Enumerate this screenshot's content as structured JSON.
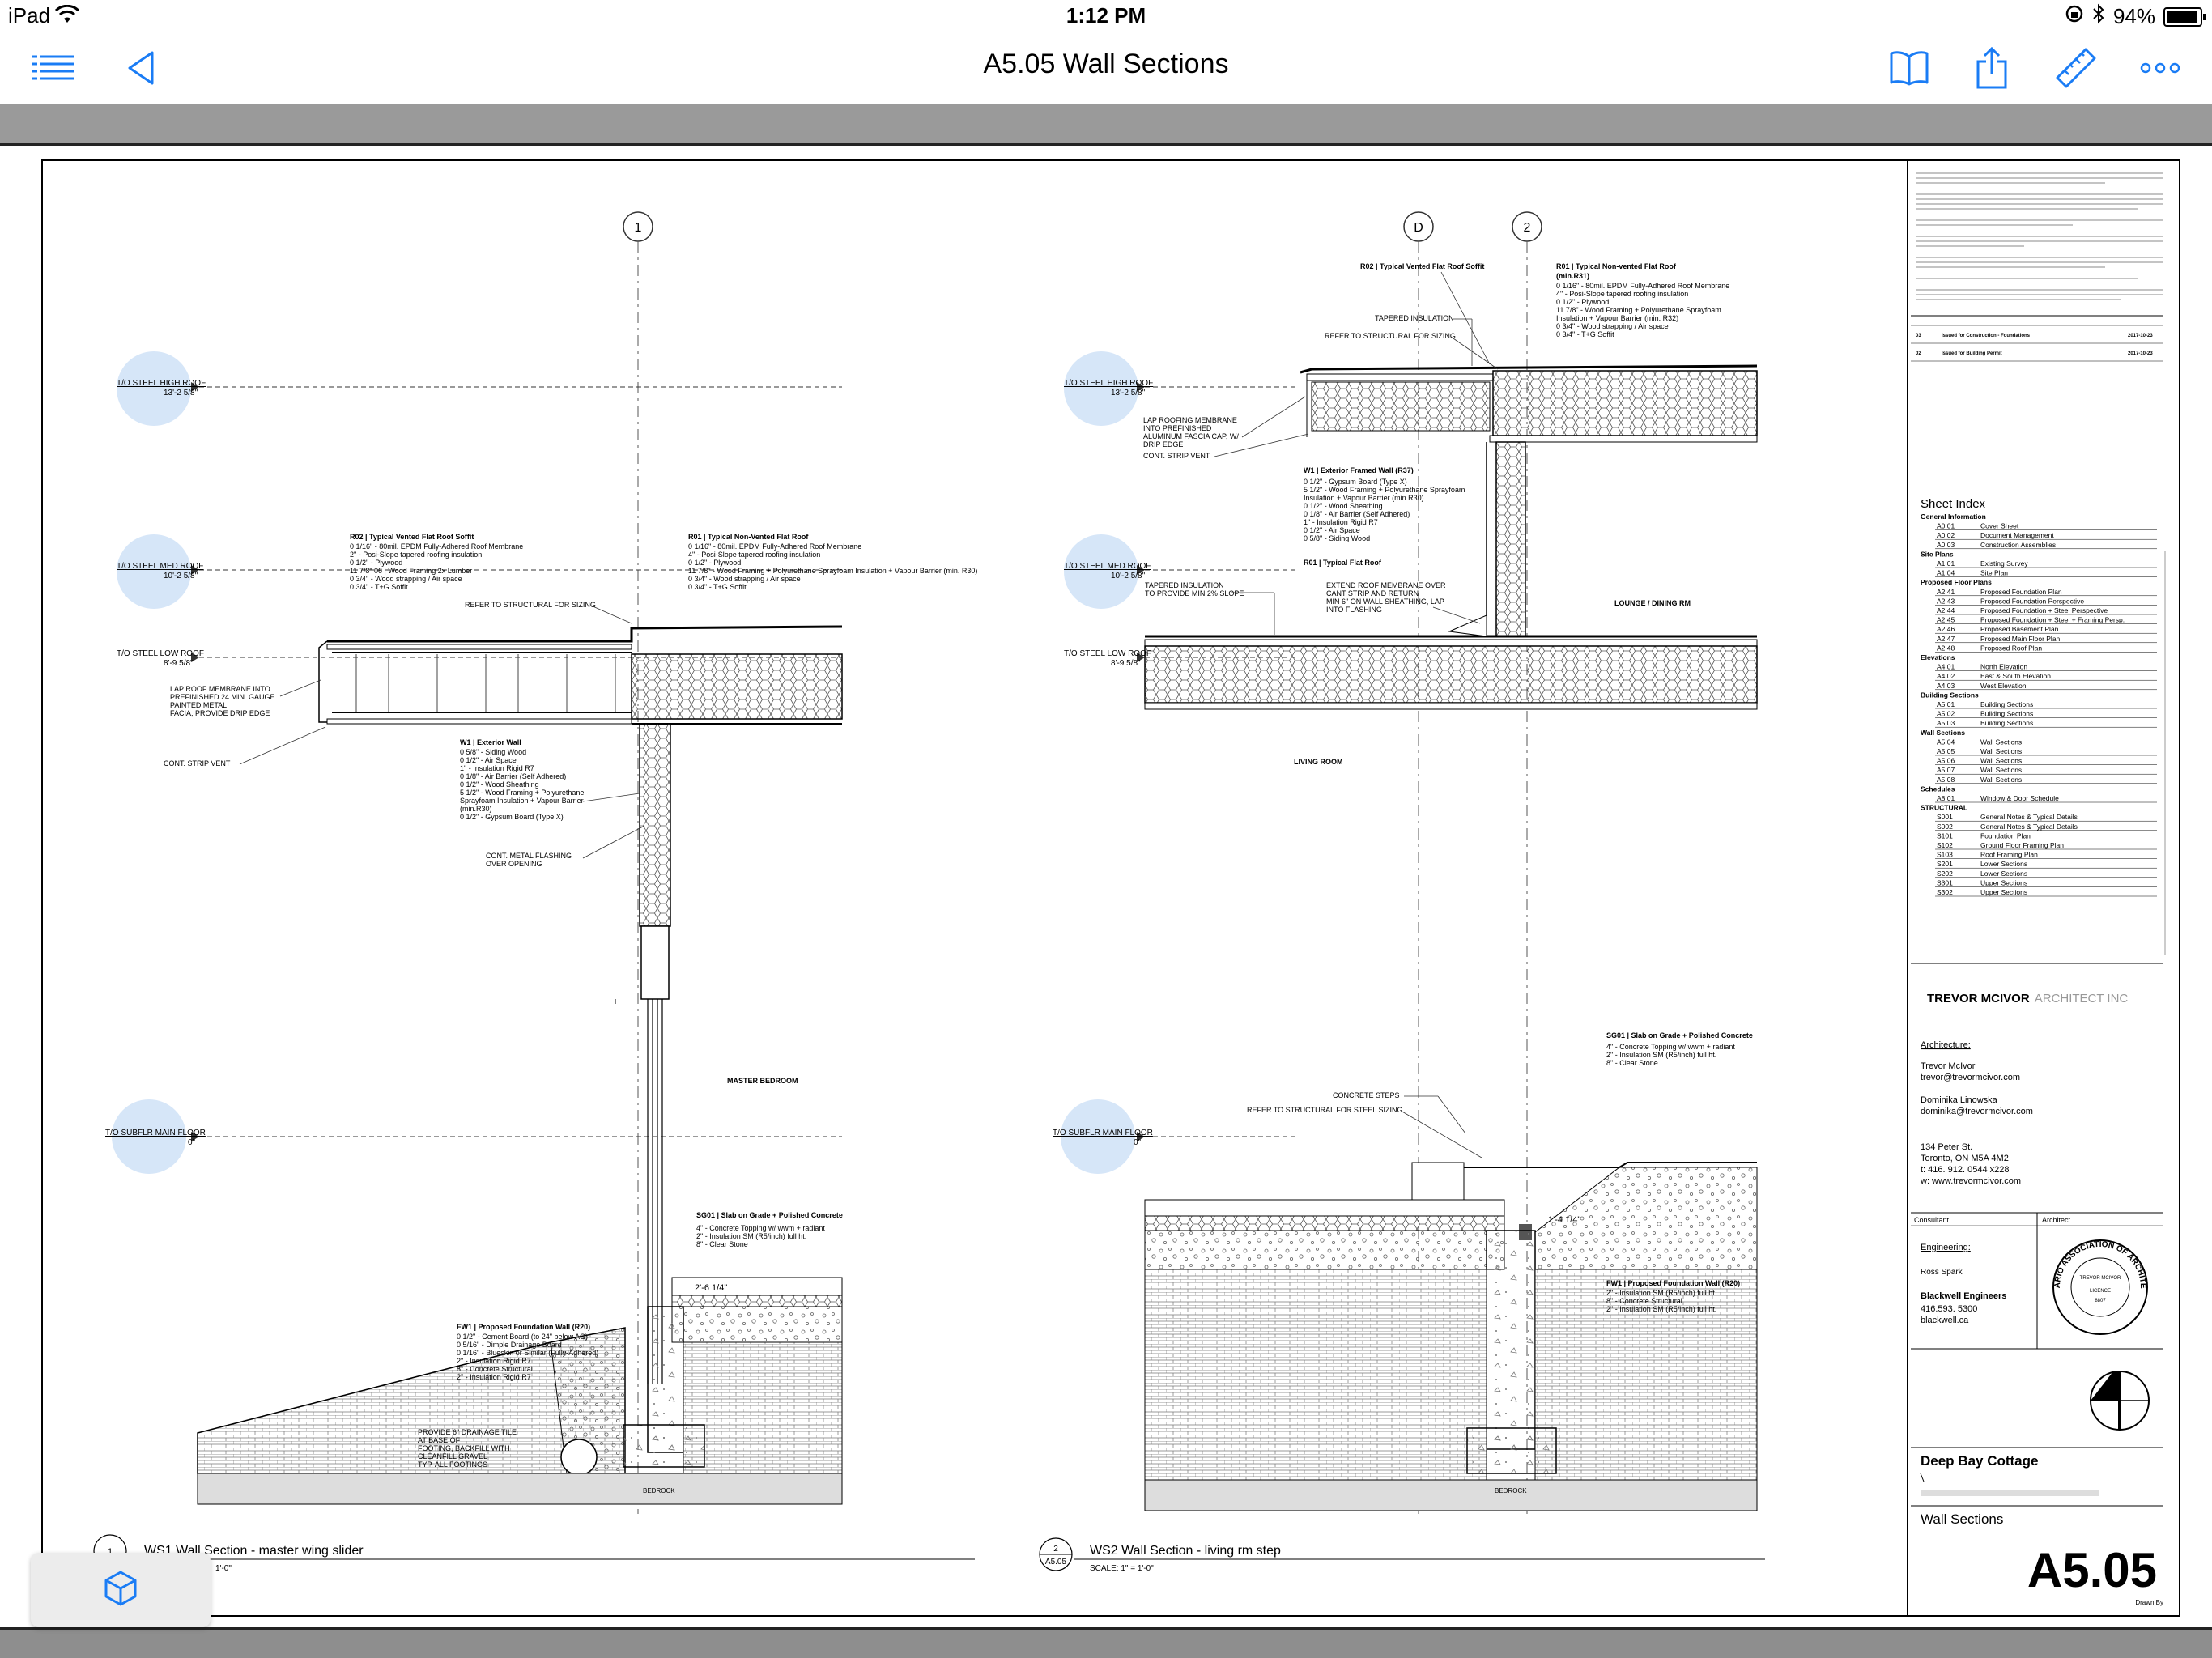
{
  "status_bar": {
    "device": "iPad",
    "time": "1:12 PM",
    "battery": "94%",
    "battery_level": 0.94
  },
  "nav_bar": {
    "title": "A5.05 Wall Sections",
    "left_icons": [
      "list-icon",
      "back-triangle-icon"
    ],
    "right_icons": [
      "book-icon",
      "share-icon",
      "ruler-icon",
      "more-icon"
    ]
  },
  "colors": {
    "accent": "#1a7cf5",
    "level_marker": "#d6e6f8",
    "nav_bg": "#ffffff",
    "strip": "#9a9a9a"
  },
  "drawing": {
    "grid_labels": {
      "left": "1",
      "mid": "D",
      "right": "2"
    },
    "levels": {
      "high_roof": {
        "label": "T/O STEEL HIGH ROOF",
        "value": "13'-2 5/8\""
      },
      "med_roof": {
        "label": "T/O STEEL MED ROOF",
        "value": "10'-2 5/8\""
      },
      "low_roof": {
        "label": "T/O STEEL LOW ROOF",
        "value": "8'-9 5/8\""
      },
      "subflr": {
        "label": "T/O SUBFLR MAIN FLOOR",
        "value": "0\""
      }
    },
    "ws1": {
      "r02_title": "R02 | Typical Vented Flat Roof Soffit",
      "r02_lines": [
        "0 1/16\" - 80mil. EPDM Fully-Adhered Roof Membrane",
        "2\" - Posi-Slope tapered roofing insulation",
        "0 1/2\" - Plywood",
        "11 7/8\" 06 | Wood Framing 2x Lumber",
        "0 3/4\" - Wood strapping / Air space",
        "0 3/4\" - T+G Soffit"
      ],
      "r01_title": "R01 | Typical Non-Vented Flat Roof",
      "r01_lines": [
        "0 1/16\" - 80mil. EPDM Fully-Adhered Roof Membrane",
        "4\" - Posi-Slope tapered roofing insulation",
        "0 1/2\" - Plywood",
        "11 7/8\" - Wood Framing + Polyurethane Sprayfoam Insulation + Vapour Barrier (min. R30)",
        "0 3/4\" - Wood strapping / Air space",
        "0 3/4\" - T+G Soffit"
      ],
      "refer_structural": "REFER TO STRUCTURAL FOR SIZING",
      "lap_roof": [
        "LAP ROOF MEMBRANE INTO",
        "PREFINISHED 24 MIN. GAUGE",
        "PAINTED METAL",
        "FACIA, PROVIDE DRIP EDGE"
      ],
      "cont_strip_vent": "CONT. STRIP VENT",
      "w1_title": "W1 | Exterior Wall",
      "w1_lines": [
        "0 5/8\" - Siding Wood",
        "0 1/2\" - Air Space",
        "1\" - Insulation Rigid R7",
        "0 1/8\" - Air Barrier (Self Adhered)",
        "0 1/2\" - Wood Sheathing",
        "5 1/2\" - Wood Framing + Polyurethane",
        "Sprayfoam Insulation + Vapour Barrier",
        "(min.R30)",
        "0 1/2\" - Gypsum Board (Type X)"
      ],
      "cont_metal_flashing": [
        "CONT. METAL FLASHING",
        "OVER OPENING"
      ],
      "master_bedroom": "MASTER BEDROOM",
      "sg01_title": "SG01 | Slab on Grade + Polished Concrete",
      "sg01_lines": [
        "4\" - Concrete Topping w/ wwm + radiant",
        "2\" - Insulation SM (R5/inch) full ht.",
        "8\" - Clear Stone"
      ],
      "dim": "2'-6 1/4\"",
      "fw1_title": "FW1 | Proposed Foundation Wall (R20)",
      "fw1_lines": [
        "0 1/2\" - Cement Board (to 24\" below AG)",
        "0 5/16\" - Dimple Drainage Board",
        "0 1/16\" - Blueskin or Similar (Fully-Adhered)",
        "2\" - Insulation Rigid R7",
        "8\" - Concrete Structural",
        "2\" - Insulation Rigid R7"
      ],
      "drainage": [
        "PROVIDE 6\" DRAINAGE TILE",
        "AT BASE OF",
        "FOOTING, BACKFILL WITH",
        "CLEANFILL GRAVEL",
        "TYP. ALL FOOTINGS"
      ],
      "bedrock": "BEDROCK",
      "caption_num": "1",
      "caption": "WS1 Wall Section - master wing slider",
      "scale": "1'-0\""
    },
    "ws2": {
      "r02_title": "R02 | Typical Vented Flat Roof Soffit",
      "r01_title": "R01 | Typical Non-vented Flat Roof",
      "r01_subtitle": "(min.R31)",
      "r01_lines": [
        "0 1/16\" - 80mil. EPDM Fully-Adhered Roof Membrane",
        "4\" - Posi-Slope tapered roofing insulation",
        "0 1/2\" - Plywood",
        "11 7/8\" - Wood Framing + Polyurethane Sprayfoam",
        "Insulation + Vapour Barrier (min. R32)",
        "0 3/4\" - Wood strapping / Air space",
        "0 3/4\" - T+G Soffit"
      ],
      "tapered_insulation": "TAPERED INSULATION",
      "refer_structural": "REFER TO STRUCTURAL FOR SIZING",
      "lap_roofing": [
        "LAP ROOFING MEMBRANE",
        "INTO PREFINISHED",
        "ALUMINUM FASCIA CAP, W/",
        "DRIP EDGE"
      ],
      "cont_strip_vent": "CONT. STRIP VENT",
      "w1_title": "W1 | Exterior Framed Wall (R37)",
      "w1_lines": [
        "0 1/2\" - Gypsum Board (Type X)",
        "5 1/2\" - Wood Framing + Polyurethane Sprayfoam",
        "Insulation + Vapour Barrier (min.R30)",
        "0 1/2\" - Wood Sheathing",
        "0 1/8\" - Air Barrier (Self Adhered)",
        "1\" - Insulation Rigid R7",
        "0 1/2\" - Air Space",
        "0 5/8\" - Siding Wood"
      ],
      "r01b_title": "R01 | Typical Flat Roof",
      "tapered_slope": [
        "TAPERED INSULATION",
        "TO PROVIDE MIN 2% SLOPE"
      ],
      "extend_roof": [
        "EXTEND ROOF MEMBRANE OVER",
        "CANT STRIP AND RETURN",
        "MIN 6\" ON WALL SHEATHING, LAP",
        "INTO FLASHING"
      ],
      "lounge": "LOUNGE / DINING RM",
      "living_room": "LIVING ROOM",
      "sg01_title": "SG01 | Slab on Grade + Polished Concrete",
      "sg01_lines": [
        "4\" - Concrete Topping w/ wwm + radiant",
        "2\" - Insulation SM (R5/inch) full ht.",
        "8\" - Clear Stone"
      ],
      "concrete_steps": "CONCRETE STEPS",
      "refer_steel": "REFER TO STRUCTURAL FOR STEEL SIZING",
      "dim": "1'-4 1/4\"",
      "fw1_title": "FW1 | Proposed Foundation Wall (R20)",
      "fw1_lines": [
        "2\" - Insulation SM (R5/inch) full ht.",
        "8\" - Concrete Structural",
        "2\" - Insulation SM (R5/inch) full ht."
      ],
      "bedrock": "BEDROCK",
      "caption_num": "2",
      "caption_ref": "A5.05",
      "caption": "WS2 Wall Section - living rm step",
      "scale": "SCALE: 1\" = 1'-0\""
    }
  },
  "title_block": {
    "issues": [
      {
        "num": "03",
        "name": "Issued for Construction - Foundations",
        "date": "2017-10-23"
      },
      {
        "num": "02",
        "name": "Issued for Building Permit",
        "date": "2017-10-23"
      }
    ],
    "sheet_index_title": "Sheet Index",
    "sheet_index": [
      {
        "group": "General Information",
        "sheets": [
          [
            "A0.01",
            "Cover Sheet"
          ],
          [
            "A0.02",
            "Document Management"
          ],
          [
            "A0.03",
            "Construction Assemblies"
          ]
        ]
      },
      {
        "group": "Site Plans",
        "sheets": [
          [
            "A1.01",
            "Existing Survey"
          ],
          [
            "A1.04",
            "Site Plan"
          ]
        ]
      },
      {
        "group": "Proposed Floor Plans",
        "sheets": [
          [
            "A2.41",
            "Proposed Foundation Plan"
          ],
          [
            "A2.43",
            "Proposed Foundation Perspective"
          ],
          [
            "A2.44",
            "Proposed Foundation + Steel Perspective"
          ],
          [
            "A2.45",
            "Proposed Foundation + Steel + Framing Persp."
          ],
          [
            "A2.46",
            "Proposed Basement Plan"
          ],
          [
            "A2.47",
            "Proposed Main Floor Plan"
          ],
          [
            "A2.48",
            "Proposed Roof Plan"
          ]
        ]
      },
      {
        "group": "Elevations",
        "sheets": [
          [
            "A4.01",
            "North Elevation"
          ],
          [
            "A4.02",
            "East & South Elevation"
          ],
          [
            "A4.03",
            "West Elevation"
          ]
        ]
      },
      {
        "group": "Building Sections",
        "sheets": [
          [
            "A5.01",
            "Building Sections"
          ],
          [
            "A5.02",
            "Building Sections"
          ],
          [
            "A5.03",
            "Building Sections"
          ]
        ]
      },
      {
        "group": "Wall Sections",
        "sheets": [
          [
            "A5.04",
            "Wall Sections"
          ],
          [
            "A5.05",
            "Wall Sections"
          ],
          [
            "A5.06",
            "Wall Sections"
          ],
          [
            "A5.07",
            "Wall Sections"
          ],
          [
            "A5.08",
            "Wall Sections"
          ]
        ]
      },
      {
        "group": "Schedules",
        "sheets": [
          [
            "A8.01",
            "Window & Door Schedule"
          ]
        ]
      },
      {
        "group": "STRUCTURAL",
        "sheets": [
          [
            "S001",
            "General Notes & Typical Details"
          ],
          [
            "S002",
            "General Notes & Typical Details"
          ],
          [
            "S101",
            "Foundation Plan"
          ],
          [
            "S102",
            "Ground Floor Framing Plan"
          ],
          [
            "S103",
            "Roof Framing Plan"
          ],
          [
            "S201",
            "Lower Sections"
          ],
          [
            "S202",
            "Lower Sections"
          ],
          [
            "S301",
            "Upper Sections"
          ],
          [
            "S302",
            "Upper Sections"
          ]
        ]
      }
    ],
    "firm_bold": "TREVOR MCIVOR",
    "firm_light": "ARCHITECT INC",
    "architecture_label": "Architecture:",
    "architects": [
      {
        "name": "Trevor McIvor",
        "email": "trevor@trevormcivor.com"
      },
      {
        "name": "Dominika Linowska",
        "email": "dominika@trevormcivor.com"
      }
    ],
    "address": [
      "134 Peter St.",
      "Toronto, ON M5A 4M2",
      "t: 416. 912. 0544 x228",
      "w: www.trevormcivor.com"
    ],
    "consultant_label": "Consultant",
    "architect_label": "Architect",
    "engineering_label": "Engineering:",
    "engineer": "Ross Spark",
    "eng_firm": "Blackwell Engineers",
    "eng_phone": "416.593. 5300",
    "eng_web": "blackwell.ca",
    "seal_top": "ONTARIO ASSOCIATION OF ARCHITECTS",
    "seal_mid": "TREVOR MCIVOR",
    "seal_licence": "LICENCE",
    "seal_no": "8807",
    "project": "Deep Bay Cottage",
    "sheet_title": "Wall Sections",
    "sheet_number": "A5.05",
    "drawn_by": "Drawn By"
  }
}
